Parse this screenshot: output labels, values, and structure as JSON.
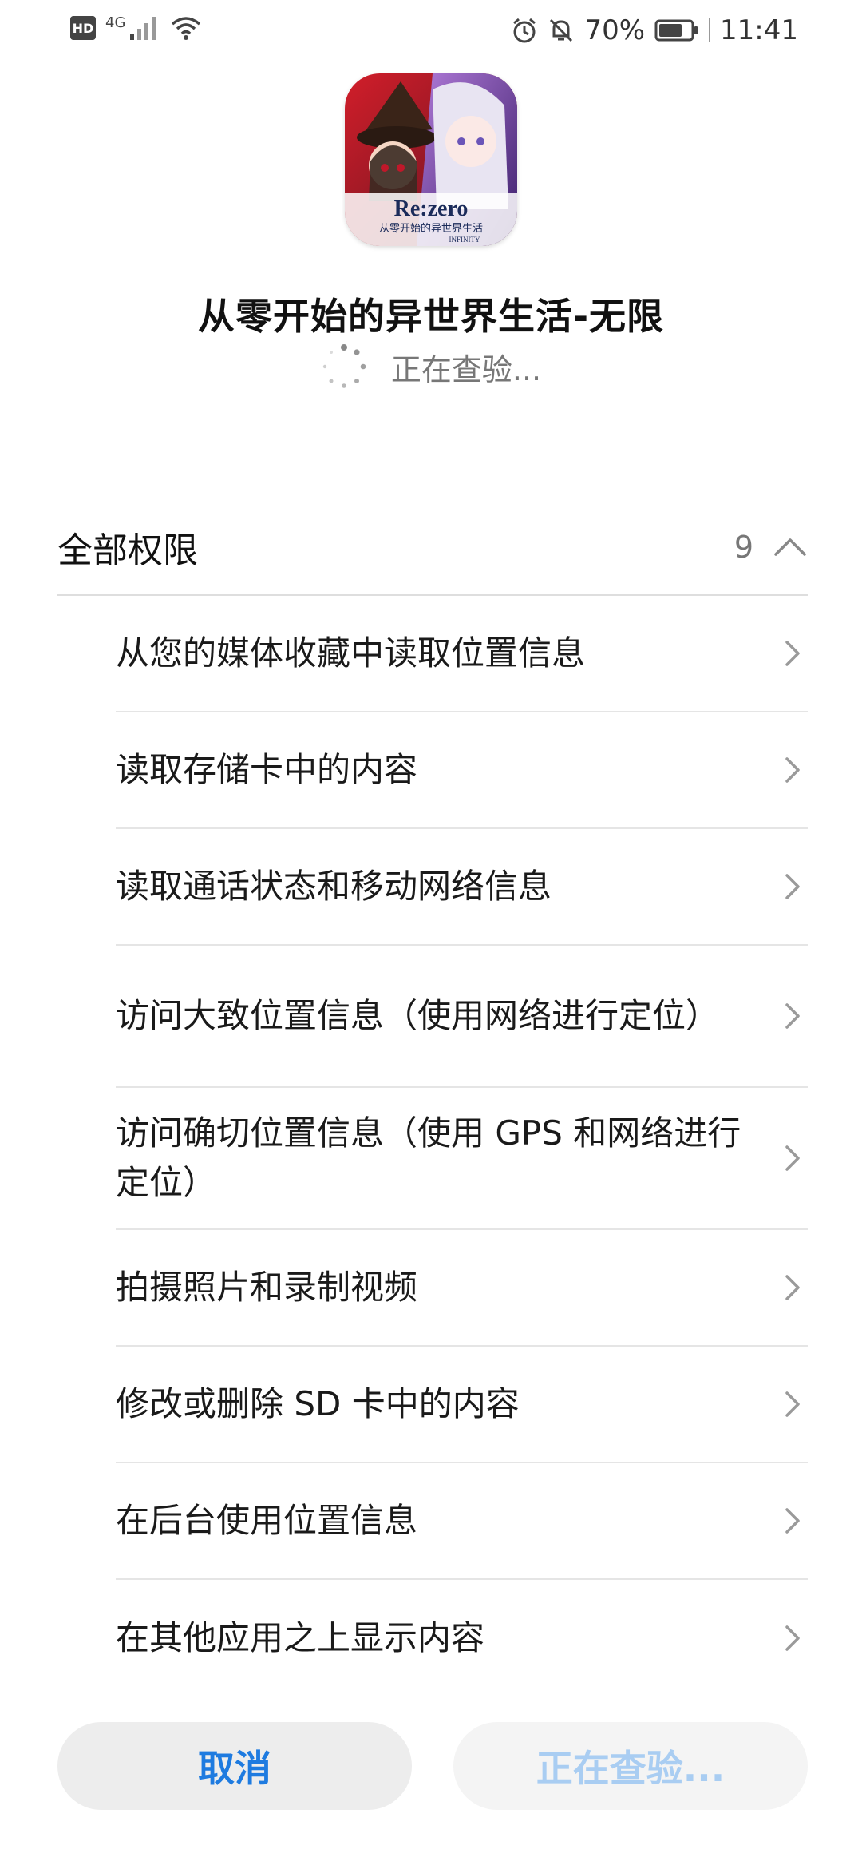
{
  "status_bar": {
    "left_badge": "HD",
    "network": "4G",
    "battery": "70%",
    "time": "11:41",
    "icons": [
      "hd-icon",
      "signal-icon",
      "wifi-icon",
      "alarm-icon",
      "mute-icon",
      "battery-icon"
    ]
  },
  "app": {
    "name": "从零开始的异世界生活-无限",
    "status": "正在查验...",
    "icon_text_1": "Re:zero",
    "icon_text_2": "从零开始的异世界生活",
    "icon_text_3": "INFINITY"
  },
  "permissions": {
    "title": "全部权限",
    "count": "9",
    "items": [
      {
        "label": "从您的媒体收藏中读取位置信息"
      },
      {
        "label": "读取存储卡中的内容"
      },
      {
        "label": "读取通话状态和移动网络信息"
      },
      {
        "label": "访问大致位置信息（使用网络进行定位）"
      },
      {
        "label": "访问确切位置信息（使用 GPS 和网络进行定位）"
      },
      {
        "label": "拍摄照片和录制视频"
      },
      {
        "label": "修改或删除 SD 卡中的内容"
      },
      {
        "label": "在后台使用位置信息"
      },
      {
        "label": "在其他应用之上显示内容"
      }
    ]
  },
  "buttons": {
    "cancel": "取消",
    "install": "正在查验..."
  },
  "colors": {
    "accent": "#1e7be0",
    "disabled_accent": "#a9cdf2",
    "button_bg": "#ededed"
  }
}
